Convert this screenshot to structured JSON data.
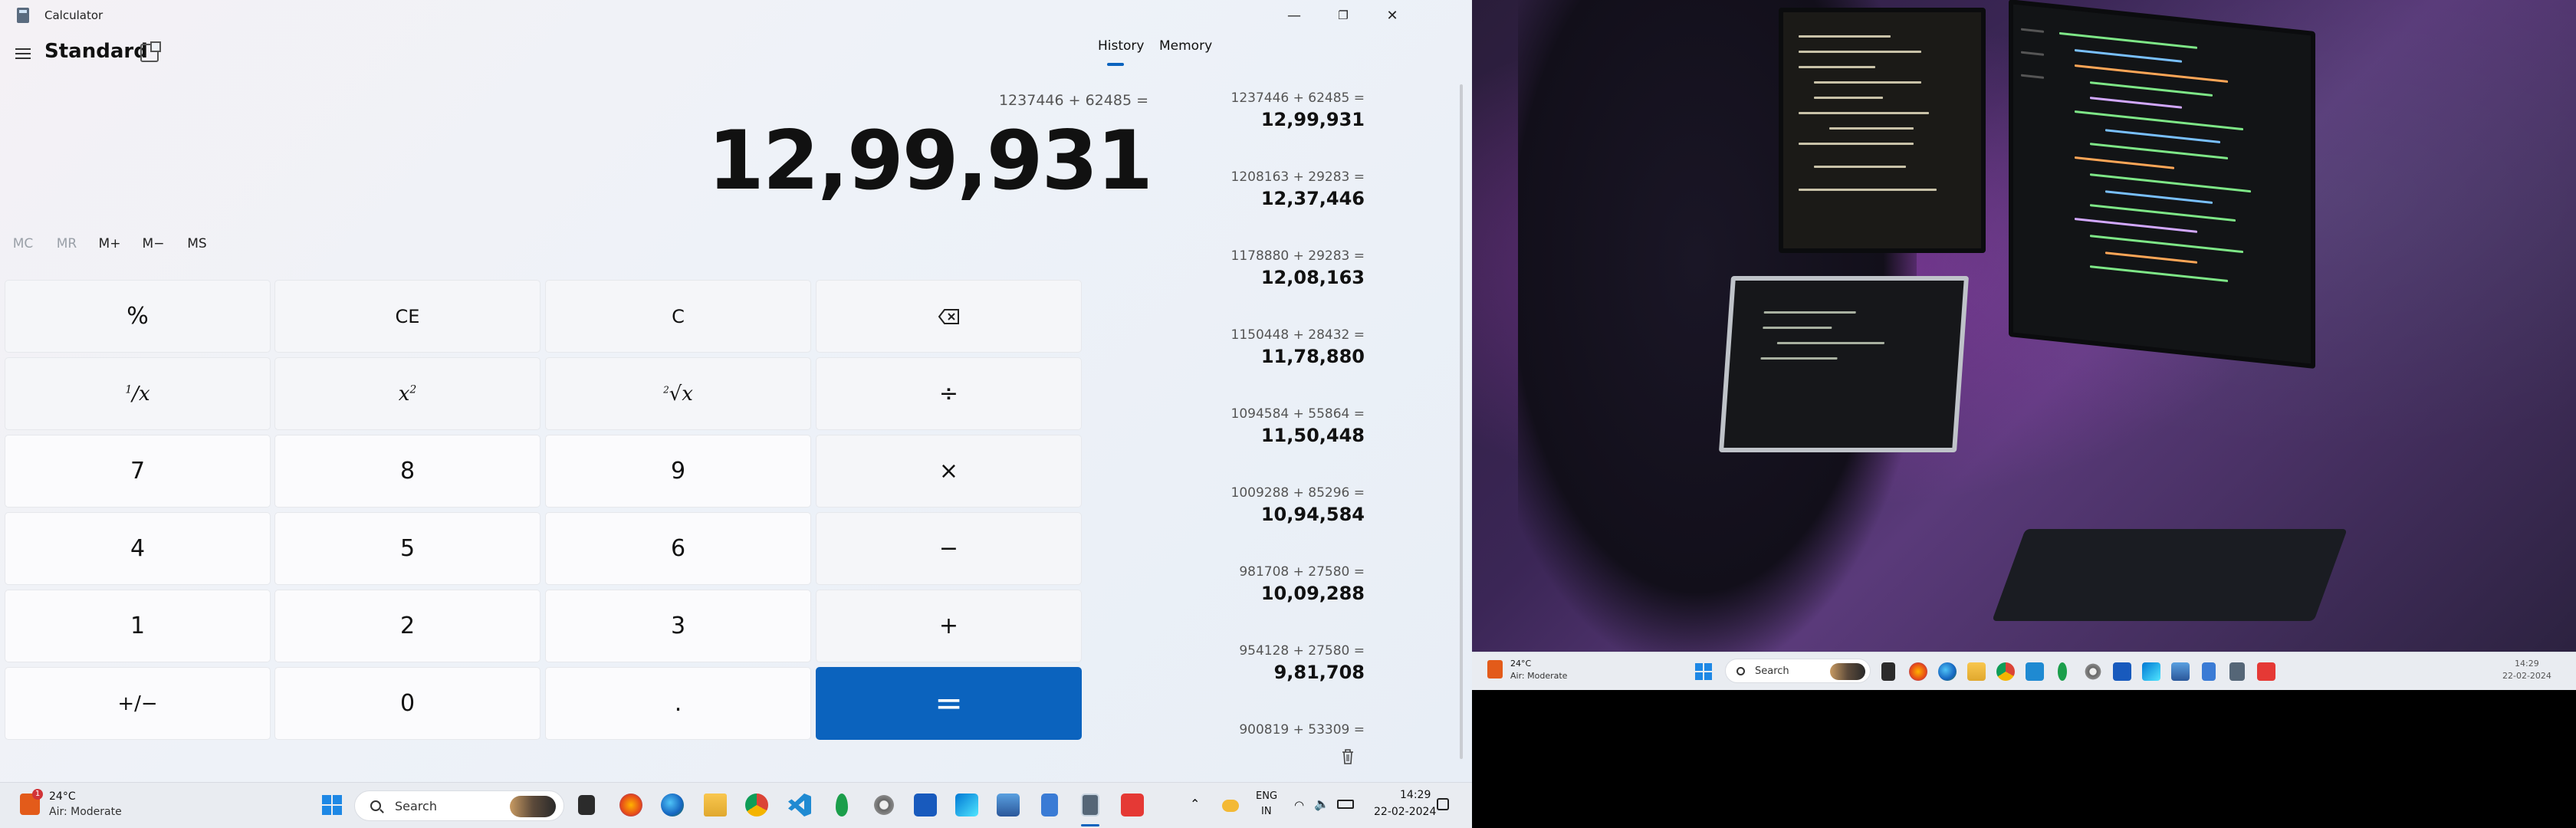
{
  "window": {
    "title": "Calculator",
    "minimize": "—",
    "maximize": "❐",
    "close": "✕"
  },
  "mode": {
    "title": "Standard"
  },
  "display": {
    "expression": "1237446 + 62485 =",
    "result": "12,99,931"
  },
  "memory": {
    "mc": "MC",
    "mr": "MR",
    "mplus": "M+",
    "mminus": "M−",
    "ms": "MS"
  },
  "keys": {
    "percent": "%",
    "ce": "CE",
    "c": "C",
    "seven": "7",
    "eight": "8",
    "nine": "9",
    "four": "4",
    "five": "5",
    "six": "6",
    "one": "1",
    "two": "2",
    "three": "3",
    "negate": "+/−",
    "zero": "0",
    "decimal": ".",
    "divide": "÷",
    "multiply": "×",
    "minus": "−",
    "plus": "+",
    "equals": "="
  },
  "panel": {
    "history_tab": "History",
    "memory_tab": "Memory"
  },
  "history": [
    {
      "expr": "1237446  +  62485 =",
      "result": "12,99,931"
    },
    {
      "expr": "1208163  +  29283 =",
      "result": "12,37,446"
    },
    {
      "expr": "1178880  +  29283 =",
      "result": "12,08,163"
    },
    {
      "expr": "1150448  +  28432 =",
      "result": "11,78,880"
    },
    {
      "expr": "1094584  +  55864 =",
      "result": "11,50,448"
    },
    {
      "expr": "1009288  +  85296 =",
      "result": "10,94,584"
    },
    {
      "expr": "981708  +  27580 =",
      "result": "10,09,288"
    },
    {
      "expr": "954128  +  27580 =",
      "result": "9,81,708"
    },
    {
      "expr": "900819  +  53309 =",
      "result": ""
    }
  ],
  "taskbar": {
    "weather_badge": "1",
    "weather_temp": "24°C",
    "weather_desc": "Air: Moderate",
    "search_label": "Search",
    "lang": "ENG",
    "region": "IN",
    "time": "14:29",
    "date": "22-02-2024"
  },
  "taskbar2": {
    "weather_temp": "24°C",
    "weather_desc": "Air: Moderate",
    "search_label": "Search",
    "time": "14:29",
    "date": "22-02-2024"
  },
  "colors": {
    "accent": "#0b63be",
    "equals_bg": "#0b63be"
  }
}
